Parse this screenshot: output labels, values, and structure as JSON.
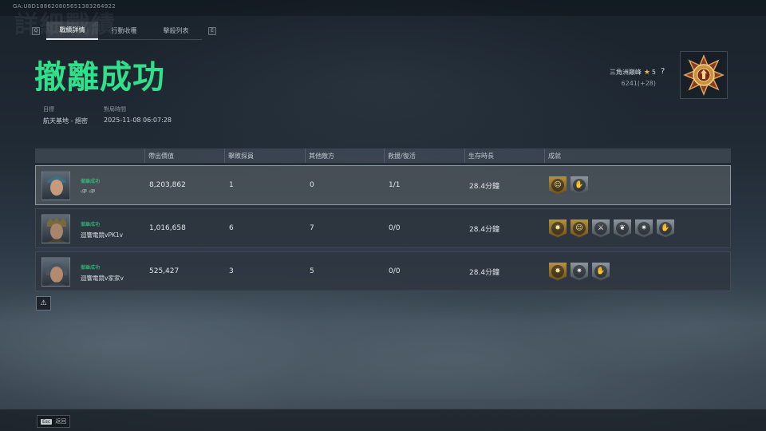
{
  "session_id": "GA:U8D188620805651383264922",
  "bg_title": "詳細戰績",
  "nav": {
    "prev_key": "Q",
    "next_key": "E",
    "tabs": [
      {
        "label": "戰績詳情",
        "active": true
      },
      {
        "label": "行動收穫",
        "active": false
      },
      {
        "label": "擊殺列表",
        "active": false
      }
    ]
  },
  "headline": "撤離成功",
  "meta": {
    "target_label": "目標",
    "target_value": "航天基地 - 絕密",
    "time_label": "對局時間",
    "time_value": "2025-11-08 06:07:28"
  },
  "rank": {
    "name": "三角洲巔峰",
    "star": "★",
    "level": "5",
    "points": "6241(+28)",
    "help": "?"
  },
  "table": {
    "headers": {
      "value": "帶出價值",
      "kills": "擊敗探員",
      "other": "其他敵方",
      "rescue": "救援/復活",
      "time": "生存時長",
      "achievements": "成就"
    },
    "rows": [
      {
        "status": "撤離成功",
        "name": "ঞ ঞ",
        "value": "8,203,862",
        "kills": "1",
        "other": "0",
        "rescue": "1/1",
        "time": "28.4分鐘",
        "badges": [
          {
            "type": "gold",
            "icon": "smile-icon",
            "glyph": "☺"
          },
          {
            "type": "silver",
            "icon": "hand-money-icon",
            "glyph": "✋"
          }
        ]
      },
      {
        "status": "撤離成功",
        "name": "迴響電競vPK1v",
        "value": "1,016,658",
        "kills": "6",
        "other": "7",
        "rescue": "0/0",
        "time": "28.4分鐘",
        "badges": [
          {
            "type": "gold",
            "icon": "burst-icon",
            "glyph": "✸"
          },
          {
            "type": "gold",
            "icon": "smile-icon",
            "glyph": "☺"
          },
          {
            "type": "silver",
            "icon": "sword-icon",
            "glyph": "⚔"
          },
          {
            "type": "silver",
            "icon": "wreath-icon",
            "glyph": "❦"
          },
          {
            "type": "silver",
            "icon": "star-burst-icon",
            "glyph": "✷"
          },
          {
            "type": "silver",
            "icon": "hand-money-icon",
            "glyph": "✋"
          }
        ]
      },
      {
        "status": "撤離成功",
        "name": "迴響電競v家家v",
        "value": "525,427",
        "kills": "3",
        "other": "5",
        "rescue": "0/0",
        "time": "28.4分鐘",
        "badges": [
          {
            "type": "gold",
            "icon": "burst-icon",
            "glyph": "✸"
          },
          {
            "type": "silver",
            "icon": "star-burst-icon",
            "glyph": "✷"
          },
          {
            "type": "silver",
            "icon": "hand-money-icon",
            "glyph": "✋"
          }
        ]
      }
    ]
  },
  "warning_icon": "⚠",
  "footer": {
    "esc_key": "Esc",
    "back_label": "返回"
  },
  "colors": {
    "headline": "#31e08a",
    "status": "#32d986",
    "gold_badge": "#b7913f",
    "silver_badge": "#8e979f"
  }
}
